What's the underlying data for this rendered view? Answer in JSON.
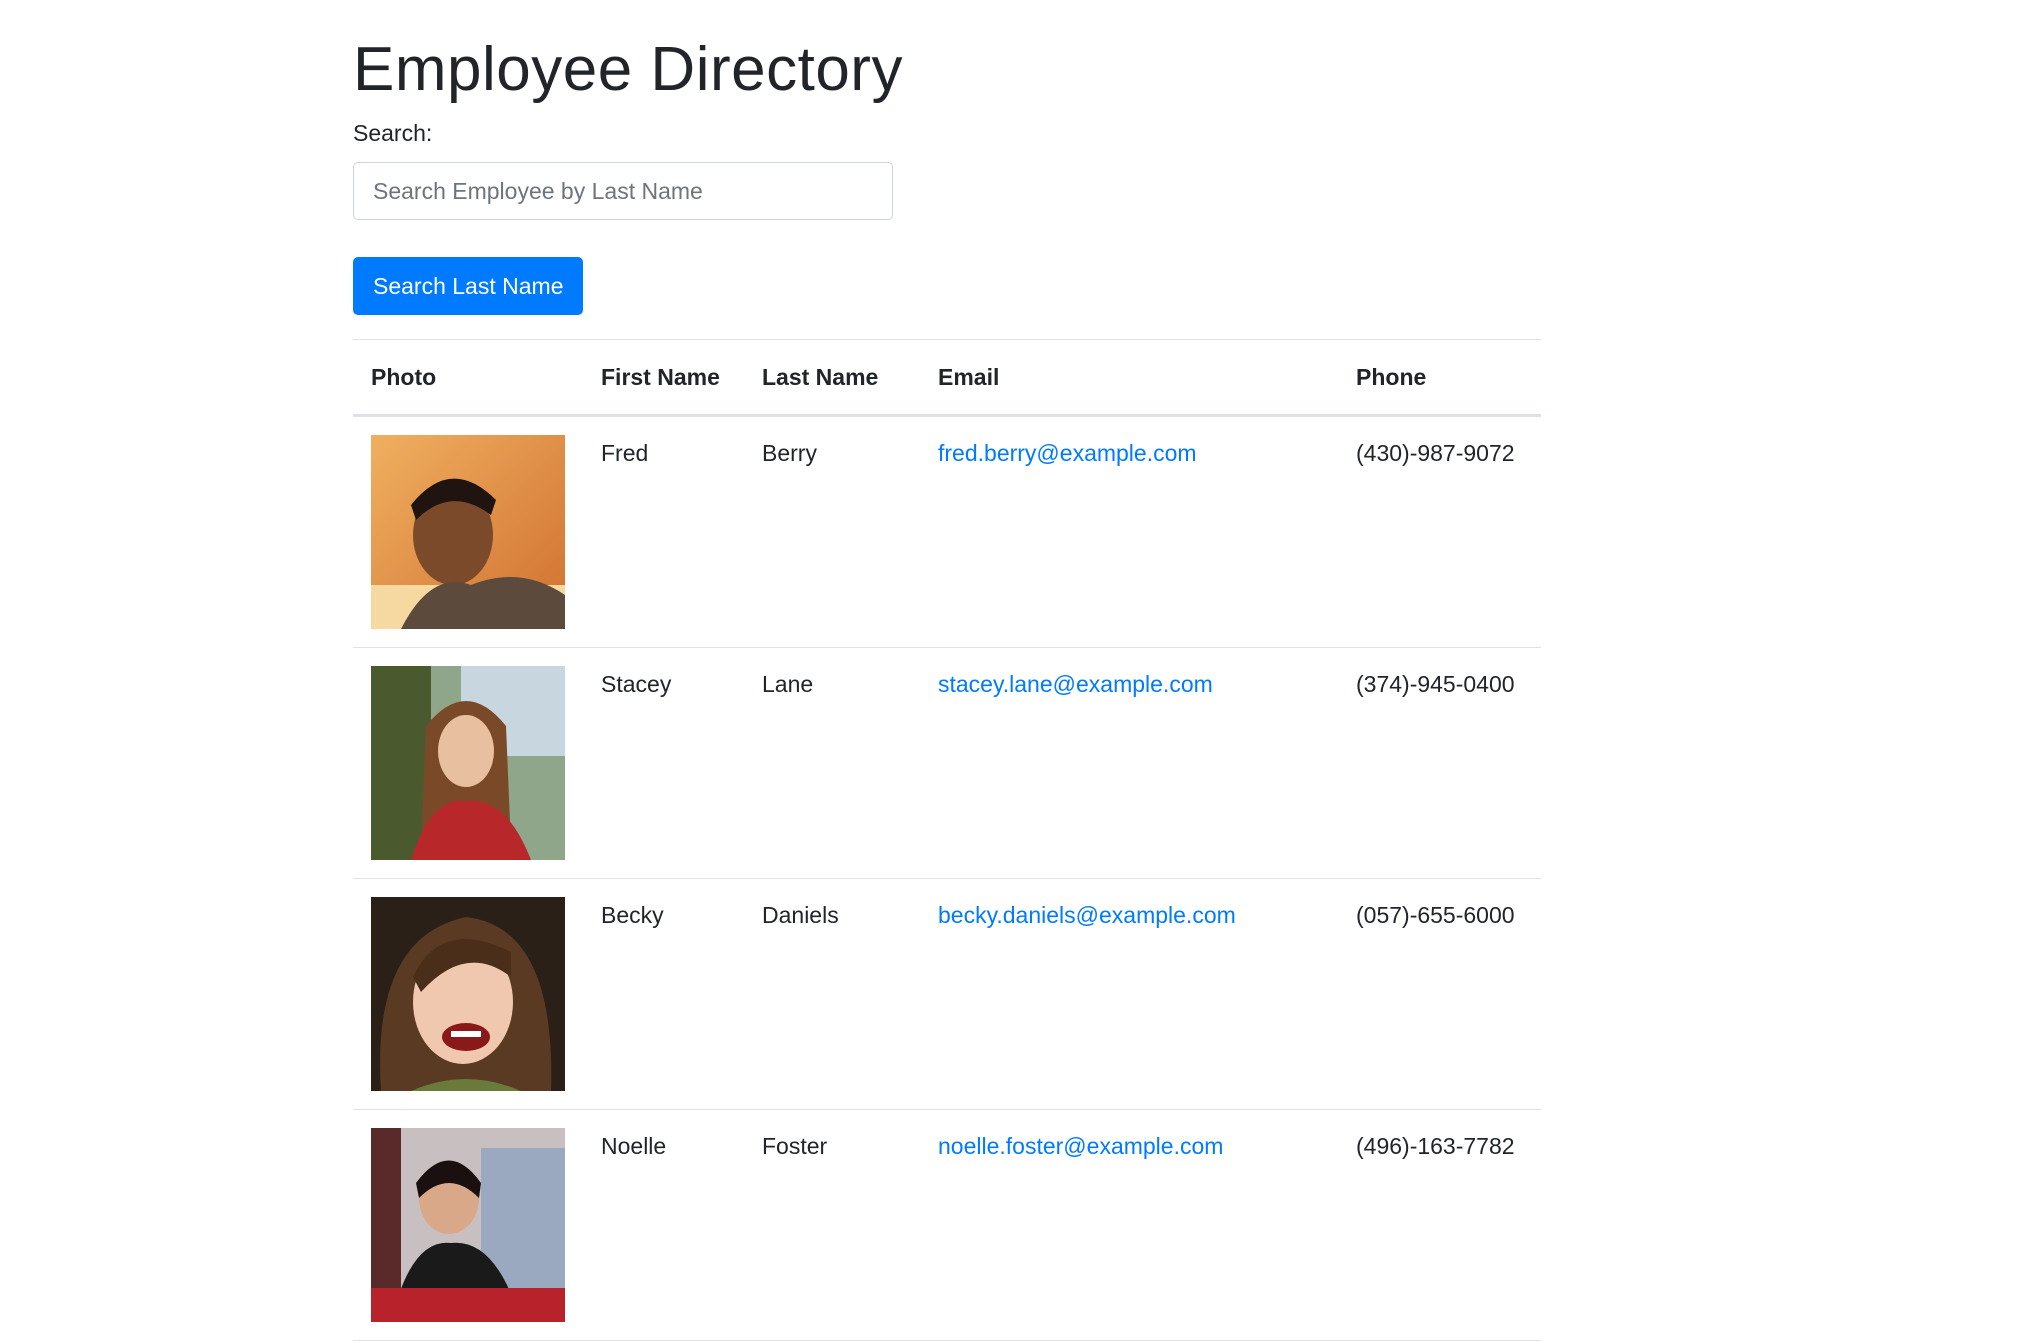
{
  "page": {
    "title": "Employee Directory"
  },
  "search": {
    "label": "Search:",
    "placeholder": "Search Employee by Last Name",
    "value": "",
    "button_label": "Search Last Name"
  },
  "colors": {
    "primary": "#007bff",
    "text": "#212529",
    "border": "#dee2e6"
  },
  "table": {
    "headers": [
      "Photo",
      "First Name",
      "Last Name",
      "Email",
      "Phone"
    ],
    "rows": [
      {
        "first": "Fred",
        "last": "Berry",
        "email": "fred.berry@example.com",
        "phone": "(430)-987-9072",
        "photo_icon": "avatar-photo"
      },
      {
        "first": "Stacey",
        "last": "Lane",
        "email": "stacey.lane@example.com",
        "phone": "(374)-945-0400",
        "photo_icon": "avatar-photo"
      },
      {
        "first": "Becky",
        "last": "Daniels",
        "email": "becky.daniels@example.com",
        "phone": "(057)-655-6000",
        "photo_icon": "avatar-photo"
      },
      {
        "first": "Noelle",
        "last": "Foster",
        "email": "noelle.foster@example.com",
        "phone": "(496)-163-7782",
        "photo_icon": "avatar-photo"
      }
    ]
  }
}
